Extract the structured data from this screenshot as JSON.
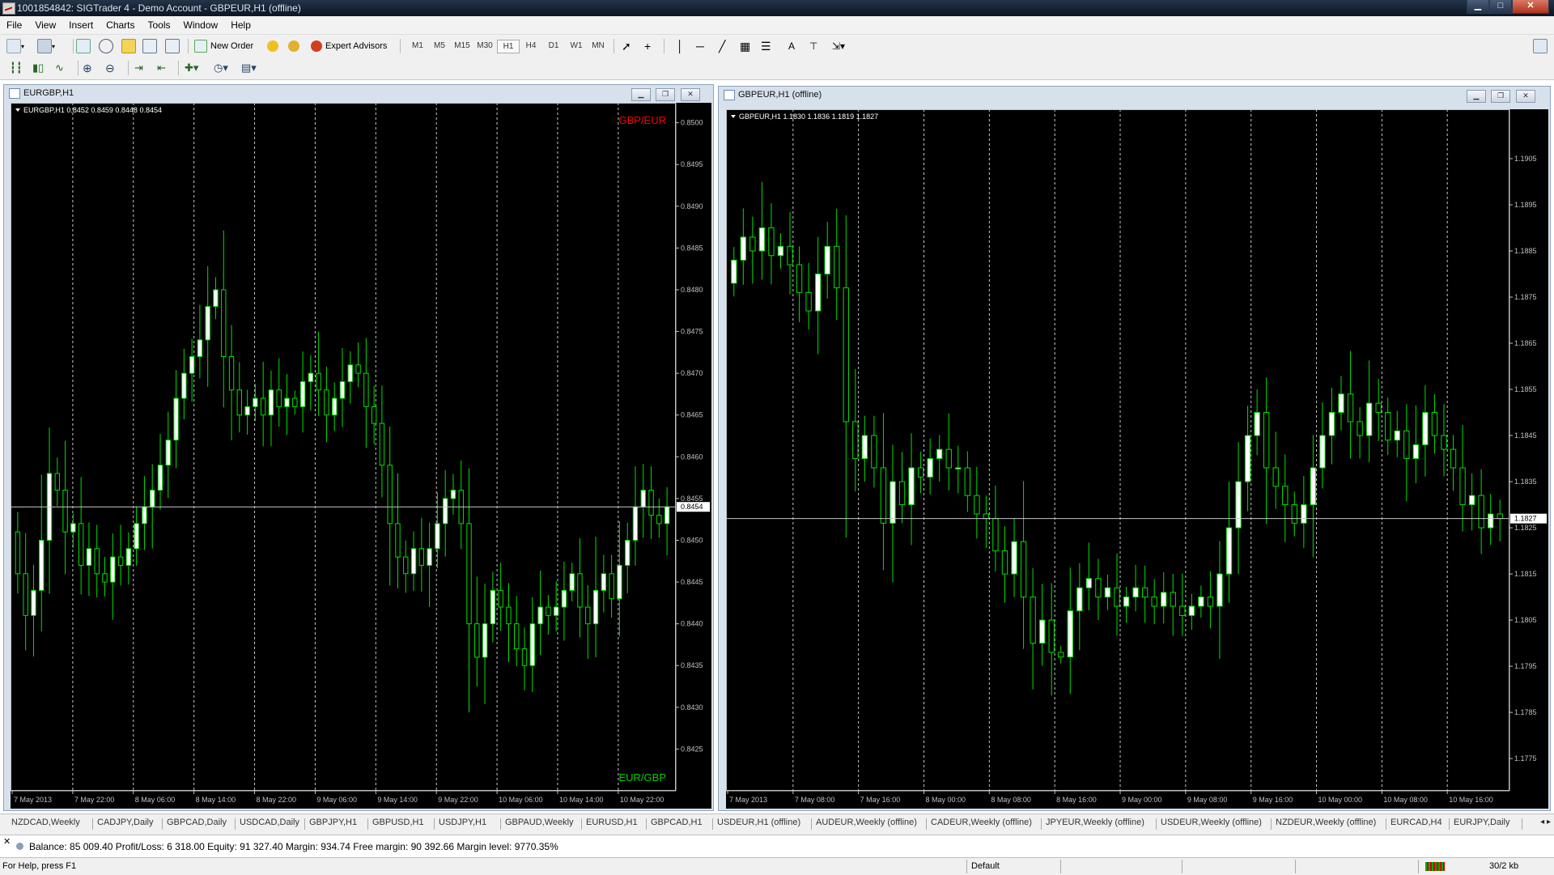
{
  "window": {
    "title": "1001854842: SIGTrader 4 - Demo Account - GBPEUR,H1 (offline)"
  },
  "menu": [
    "File",
    "View",
    "Insert",
    "Charts",
    "Tools",
    "Window",
    "Help"
  ],
  "toolbar": {
    "new_order": "New Order",
    "expert_advisors": "Expert Advisors",
    "timeframes": [
      "M1",
      "M5",
      "M15",
      "M30",
      "H1",
      "H4",
      "D1",
      "W1",
      "MN"
    ],
    "active_timeframe": "H1"
  },
  "colors": {
    "bull": "#ffffff",
    "bear": "#000000",
    "wick": "#00e000",
    "grid": "#c8c8c8",
    "axis_text": "#c0c0c0",
    "label_red": "#ff0000",
    "label_green": "#00d000"
  },
  "charts": [
    {
      "window_title": "EURGBP,H1",
      "info": "EURGBP,H1  0.8452 0.8459 0.8448 0.8454",
      "label_top": "GBP/EUR",
      "label_bottom": "EUR/GBP",
      "bid": "0.8454",
      "chart_data": {
        "type": "candlestick",
        "symbol": "EURGBP",
        "timeframe": "H1",
        "ylim": [
          0.842,
          0.8502
        ],
        "y_ticks": [
          "0.8500",
          "0.8495",
          "0.8490",
          "0.8485",
          "0.8480",
          "0.8475",
          "0.8470",
          "0.8465",
          "0.8460",
          "0.8455",
          "0.8450",
          "0.8445",
          "0.8440",
          "0.8435",
          "0.8430",
          "0.8425"
        ],
        "x_labels": [
          "7 May 2013",
          "7 May 22:00",
          "8 May 06:00",
          "8 May 14:00",
          "8 May 22:00",
          "9 May 06:00",
          "9 May 14:00",
          "9 May 22:00",
          "10 May 06:00",
          "10 May 14:00",
          "10 May 22:00"
        ],
        "last_price": 0.8454,
        "close_series": [
          0.8446,
          0.8441,
          0.8444,
          0.845,
          0.8458,
          0.8456,
          0.8451,
          0.8452,
          0.8447,
          0.8449,
          0.8446,
          0.8445,
          0.8448,
          0.8447,
          0.8449,
          0.8452,
          0.8454,
          0.8456,
          0.8459,
          0.8462,
          0.8467,
          0.847,
          0.8472,
          0.8474,
          0.8478,
          0.848,
          0.8472,
          0.8468,
          0.8465,
          0.8466,
          0.8467,
          0.8465,
          0.8468,
          0.8466,
          0.8467,
          0.8466,
          0.8469,
          0.847,
          0.8468,
          0.8465,
          0.8467,
          0.8469,
          0.8471,
          0.847,
          0.8466,
          0.8464,
          0.8459,
          0.8452,
          0.8448,
          0.8446,
          0.8449,
          0.8447,
          0.8449,
          0.8452,
          0.8455,
          0.8456,
          0.8452,
          0.844,
          0.8436,
          0.844,
          0.8444,
          0.8442,
          0.844,
          0.8437,
          0.8435,
          0.844,
          0.8442,
          0.8441,
          0.8442,
          0.8444,
          0.8446,
          0.8442,
          0.844,
          0.8444,
          0.8446,
          0.8443,
          0.8447,
          0.845,
          0.8454,
          0.8456,
          0.8453,
          0.8452,
          0.8454
        ]
      }
    },
    {
      "window_title": "GBPEUR,H1 (offline)",
      "info": "GBPEUR,H1  1.1830 1.1836 1.1819 1.1827",
      "bid": "1.1827",
      "chart_data": {
        "type": "candlestick",
        "symbol": "GBPEUR",
        "timeframe": "H1",
        "ylim": [
          1.1768,
          1.1915
        ],
        "y_ticks": [
          "1.1905",
          "1.1895",
          "1.1885",
          "1.1875",
          "1.1865",
          "1.1855",
          "1.1845",
          "1.1835",
          "1.1825",
          "1.1815",
          "1.1805",
          "1.1795",
          "1.1785",
          "1.1775"
        ],
        "x_labels": [
          "7 May 2013",
          "7 May 08:00",
          "7 May 16:00",
          "8 May 00:00",
          "8 May 08:00",
          "8 May 16:00",
          "9 May 00:00",
          "9 May 08:00",
          "9 May 16:00",
          "10 May 00:00",
          "10 May 08:00",
          "10 May 16:00"
        ],
        "last_price": 1.1827,
        "close_series": [
          1.1883,
          1.1888,
          1.1885,
          1.189,
          1.1884,
          1.1886,
          1.1882,
          1.1876,
          1.1872,
          1.188,
          1.1886,
          1.1877,
          1.1848,
          1.184,
          1.1845,
          1.1838,
          1.1826,
          1.1835,
          1.183,
          1.1838,
          1.1836,
          1.184,
          1.1842,
          1.1838,
          1.1838,
          1.1832,
          1.1828,
          1.1827,
          1.182,
          1.1815,
          1.1822,
          1.181,
          1.18,
          1.1805,
          1.1798,
          1.1797,
          1.1807,
          1.1812,
          1.1814,
          1.181,
          1.1812,
          1.1808,
          1.181,
          1.1812,
          1.181,
          1.1808,
          1.1811,
          1.1808,
          1.1806,
          1.1808,
          1.181,
          1.1808,
          1.1815,
          1.1825,
          1.1835,
          1.1845,
          1.185,
          1.1838,
          1.1834,
          1.183,
          1.1826,
          1.183,
          1.1838,
          1.1845,
          1.185,
          1.1854,
          1.1848,
          1.1845,
          1.1852,
          1.185,
          1.1844,
          1.1846,
          1.184,
          1.1843,
          1.185,
          1.1845,
          1.1842,
          1.1838,
          1.183,
          1.1832,
          1.1825,
          1.1828,
          1.1827
        ]
      }
    }
  ],
  "tabs": [
    "NZDCAD,Weekly",
    "CADJPY,Daily",
    "GBPCAD,Daily",
    "USDCAD,Daily",
    "GBPJPY,H1",
    "GBPUSD,H1",
    "USDJPY,H1",
    "GBPAUD,Weekly",
    "EURUSD,H1",
    "GBPCAD,H1",
    "USDEUR,H1 (offline)",
    "AUDEUR,Weekly (offline)",
    "CADEUR,Weekly (offline)",
    "JPYEUR,Weekly (offline)",
    "USDEUR,Weekly (offline)",
    "NZDEUR,Weekly (offline)",
    "EURCAD,H4",
    "EURJPY,Daily"
  ],
  "terminal": {
    "balance_line": "Balance: 85 009.40  Profit/Loss: 6 318.00  Equity: 91 327.40  Margin: 934.74  Free margin: 90 392.66  Margin level: 9770.35%"
  },
  "statusbar": {
    "help": "For Help, press F1",
    "profile": "Default",
    "connection": "30/2 kb"
  }
}
